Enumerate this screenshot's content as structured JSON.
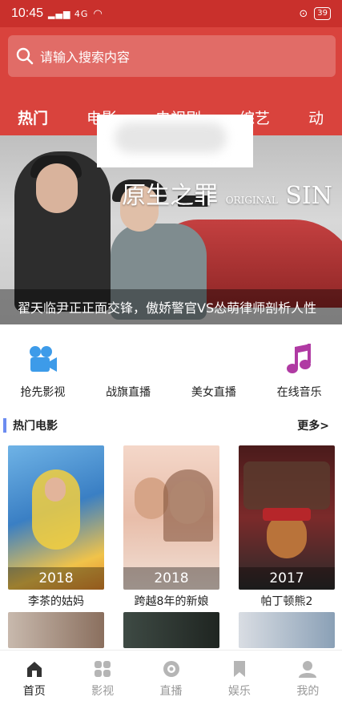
{
  "status_bar": {
    "time": "10:45",
    "signal": "4G",
    "battery": "39"
  },
  "search": {
    "placeholder": "请输入搜索内容"
  },
  "tabs": [
    "热门",
    "电影",
    "电视剧",
    "综艺",
    "动"
  ],
  "banner": {
    "film_title": "原生之罪",
    "film_title_en_small": "ORIGINAL",
    "film_title_en": "SIN",
    "caption": "翟天临尹正正面交锋，傲娇警官VS怂萌律师剖析人性"
  },
  "quick_links": [
    {
      "label": "抢先影视",
      "icon": "camera-icon",
      "color": "#3d9be9"
    },
    {
      "label": "战旗直播",
      "icon": "",
      "color": ""
    },
    {
      "label": "美女直播",
      "icon": "",
      "color": ""
    },
    {
      "label": "在线音乐",
      "icon": "music-note-icon",
      "color": "#b03aa3"
    }
  ],
  "section": {
    "title": "热门电影",
    "more": "更多>"
  },
  "movies": [
    {
      "title": "李茶的姑妈",
      "year": "2018",
      "poster_color": "#4a8fd1"
    },
    {
      "title": "跨越8年的新娘",
      "year": "2018",
      "poster_color": "#e7c6b6"
    },
    {
      "title": "帕丁顿熊2",
      "year": "2017",
      "poster_color": "#8a2a2a"
    }
  ],
  "bottom_nav": [
    {
      "label": "首页",
      "icon": "home-icon",
      "active": true
    },
    {
      "label": "影视",
      "icon": "grid-icon",
      "active": false
    },
    {
      "label": "直播",
      "icon": "live-icon",
      "active": false
    },
    {
      "label": "娱乐",
      "icon": "bookmark-icon",
      "active": false
    },
    {
      "label": "我的",
      "icon": "user-icon",
      "active": false
    }
  ]
}
